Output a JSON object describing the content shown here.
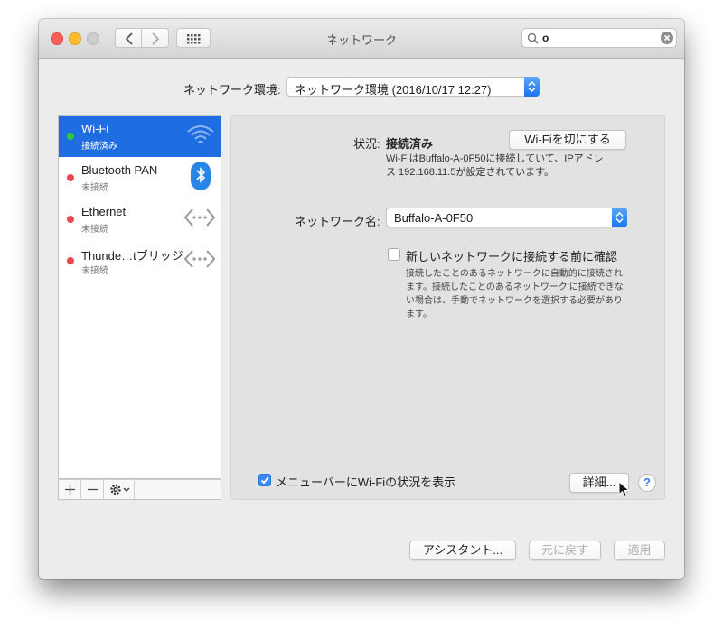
{
  "window": {
    "title": "ネットワーク"
  },
  "search": {
    "value": "o",
    "placeholder": ""
  },
  "location": {
    "label": "ネットワーク環境:",
    "selected": "ネットワーク環境 (2016/10/17 12:27)"
  },
  "services": [
    {
      "name": "Wi-Fi",
      "status": "接続済み",
      "dot_color": "#2fc53d",
      "icon": "wifi-icon",
      "selected": true
    },
    {
      "name": "Bluetooth PAN",
      "status": "未接続",
      "dot_color": "#e5484d",
      "icon": "bluetooth-icon",
      "selected": false
    },
    {
      "name": "Ethernet",
      "status": "未接続",
      "dot_color": "#e5484d",
      "icon": "ethernet-icon",
      "selected": false
    },
    {
      "name": "Thunde…tブリッジ",
      "status": "未接続",
      "dot_color": "#e5484d",
      "icon": "thunderbolt-bridge-icon",
      "selected": false
    }
  ],
  "sidebar_toolbar": {
    "add": "+",
    "remove": "−"
  },
  "detail": {
    "status_label": "状況:",
    "status_value": "接続済み",
    "toggle_wifi_button": "Wi-Fiを切にする",
    "status_desc_1": "Wi-FiはBuffalo-A-0F50に接続していて、IPアドレ",
    "status_desc_2": "ス 192.168.11.5が設定されています。",
    "network_name_label": "ネットワーク名:",
    "network_name_value": "Buffalo-A-0F50",
    "ask_join_label": "新しいネットワークに接続する前に確認",
    "ask_join_checked": false,
    "ask_join_desc_1": "接続したことのあるネットワークに自動的に接続され",
    "ask_join_desc_2": "ます。接続したことのあるネットワーク'に接続できな",
    "ask_join_desc_3": "い場合は、手動でネットワークを選択する必要があり",
    "ask_join_desc_4": "ます。",
    "show_menubar_label": "メニューバーにWi-Fiの状況を表示",
    "show_menubar_checked": true,
    "advanced_button": "詳細...",
    "help": "?"
  },
  "footer": {
    "assistant_button": "アシスタント...",
    "revert_button": "元に戻す",
    "apply_button": "適用"
  },
  "colors": {
    "accent": "#1e6ee2",
    "connected": "#2fc53d",
    "disconnected": "#e5484d"
  }
}
